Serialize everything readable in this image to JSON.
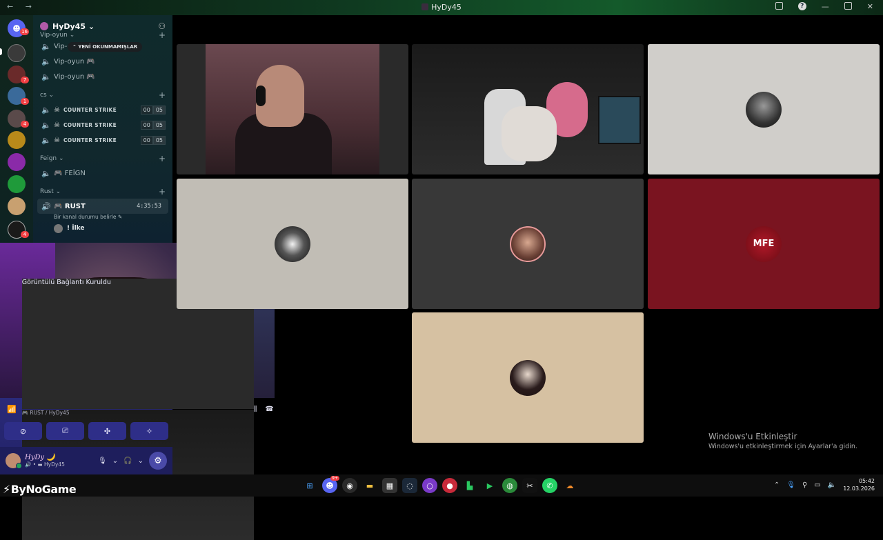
{
  "window": {
    "title": "HyDy45",
    "nav_back": "←",
    "nav_fwd": "→"
  },
  "servers": [
    {
      "name": "discord-home",
      "badge": "16",
      "color": "#5865f2"
    },
    {
      "name": "server-1",
      "badge": "",
      "color": "#4a4a4a"
    },
    {
      "name": "server-2",
      "badge": "7",
      "color": "#6a2a2a"
    },
    {
      "name": "server-3",
      "badge": "1",
      "color": "#3a6a9a"
    },
    {
      "name": "server-4",
      "badge": "4",
      "color": "#5a4a4a"
    },
    {
      "name": "server-5",
      "badge": "",
      "color": "#b88a1a"
    },
    {
      "name": "server-6",
      "badge": "",
      "color": "#8a2aa8"
    },
    {
      "name": "server-7",
      "badge": "",
      "color": "#1f9a3a"
    },
    {
      "name": "server-8",
      "badge": "",
      "color": "#c8a070"
    },
    {
      "name": "server-9",
      "badge": "4",
      "color": "#1a1a1a"
    }
  ],
  "guild": {
    "name": "HyDy45 ⌄",
    "tooltip": "YENİ OKUNMAMIŞLAR",
    "categories": [
      {
        "label": "Vip-oyun ⌄",
        "channels": [
          {
            "label": "Vip-oyun 🎮"
          },
          {
            "label": "Vip-oyun 🎮"
          },
          {
            "label": "Vip-oyun 🎮"
          }
        ]
      },
      {
        "label": "cs ⌄",
        "channels": [
          {
            "label": "COUNTER STRIKE",
            "a": "00",
            "b": "05"
          },
          {
            "label": "COUNTER STRIKE",
            "a": "00",
            "b": "05"
          },
          {
            "label": "COUNTER STRIKE",
            "a": "00",
            "b": "05"
          }
        ]
      },
      {
        "label": "Feign ⌄",
        "channels": [
          {
            "label": "🎮 FEİGN"
          }
        ]
      },
      {
        "label": "Rust ⌄",
        "channels": [
          {
            "label": "🎮  RUST",
            "timer": "4:35:53",
            "status": "Bir kanal durumu belirle ✎"
          }
        ]
      }
    ],
    "member": "! İlke"
  },
  "voice": {
    "connected": "Görüntülü Bağlantı Kuruldu",
    "location": "🎮 RUST / HyDy45",
    "user_name": "HyDy 🌙",
    "user_sub": "🔊 • ▬ HyDy45"
  },
  "watermark": {
    "line1": "Windows'u Etkinleştir",
    "line2": "Windows'u etkinleştirmek için Ayarlar'a gidin."
  },
  "brand": "ByNoGame",
  "clock": {
    "time": "05:42",
    "date": "12.03.2026"
  },
  "tiles": {
    "mfe_label": "MFE"
  },
  "taskbar_badge": "9+"
}
